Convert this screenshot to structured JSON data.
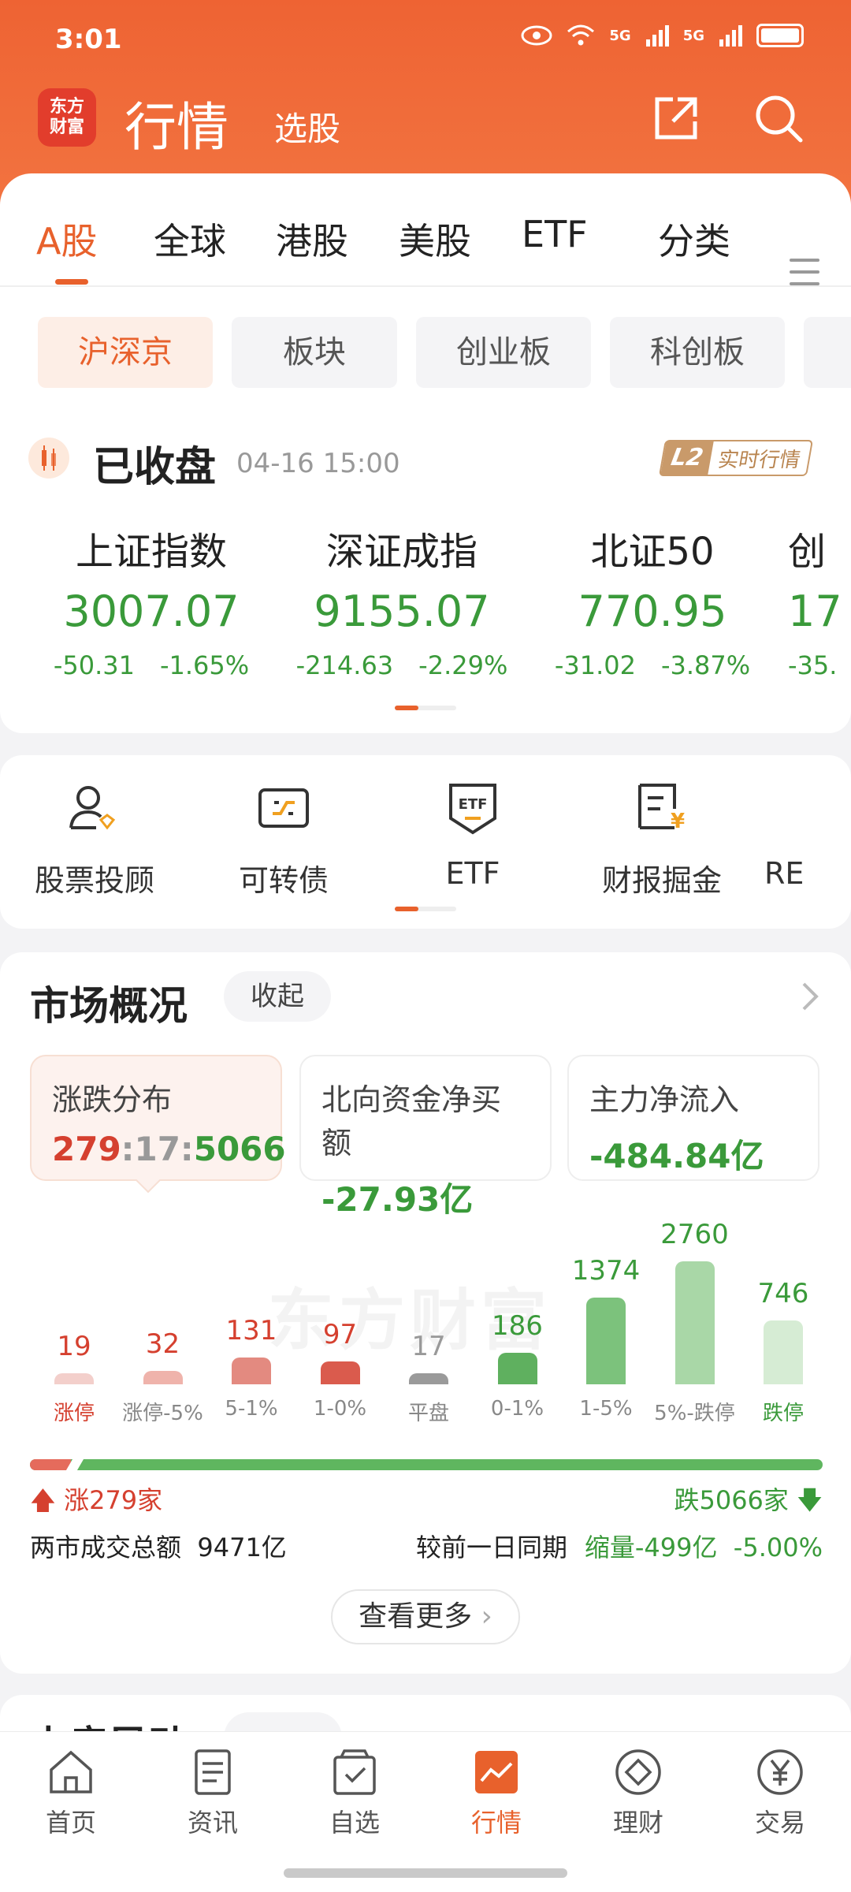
{
  "status": {
    "time": "3:01",
    "signal1": "5G",
    "signal2": "5G"
  },
  "header": {
    "logo_line1": "东方",
    "logo_line2": "财富",
    "title": "行情",
    "subtitle": "选股"
  },
  "tabs": [
    "A股",
    "全球",
    "港股",
    "美股",
    "ETF",
    "分类"
  ],
  "chips": [
    "沪深京",
    "板块",
    "创业板",
    "科创板"
  ],
  "market_status": {
    "title": "已收盘",
    "time": "04-16 15:00",
    "badge_l2": "L2",
    "badge_text": "实时行情"
  },
  "indices": [
    {
      "name": "上证指数",
      "value": "3007.07",
      "change": "-50.31",
      "pct": "-1.65%"
    },
    {
      "name": "深证成指",
      "value": "9155.07",
      "change": "-214.63",
      "pct": "-2.29%"
    },
    {
      "name": "北证50",
      "value": "770.95",
      "change": "-31.02",
      "pct": "-3.87%"
    },
    {
      "name": "创",
      "value": "17",
      "change": "-35.",
      "pct": ""
    }
  ],
  "tools": [
    {
      "label": "股票投顾",
      "icon": "advisor-icon"
    },
    {
      "label": "可转债",
      "icon": "convertible-bond-icon"
    },
    {
      "label": "ETF",
      "icon": "etf-icon"
    },
    {
      "label": "财报掘金",
      "icon": "financial-report-icon"
    },
    {
      "label": "RE",
      "icon": "reits-icon"
    }
  ],
  "overview": {
    "title": "市场概况",
    "collapse_label": "收起",
    "stats": [
      {
        "label": "涨跌分布",
        "up": "279",
        "flat": "17",
        "down": "5066",
        "sep": ":"
      },
      {
        "label": "北向资金净买额",
        "value": "-27.93亿"
      },
      {
        "label": "主力净流入",
        "value": "-484.84亿"
      }
    ],
    "watermark": "东方财富",
    "distribution": [
      {
        "label": "涨停",
        "count": 19,
        "color": "#f3cfcb",
        "text": "#d5402f"
      },
      {
        "label": "涨停-5%",
        "count": 32,
        "color": "#efb3ab",
        "text": "#d5402f"
      },
      {
        "label": "5-1%",
        "count": 131,
        "color": "#e38a80",
        "text": "#d5402f"
      },
      {
        "label": "1-0%",
        "count": 97,
        "color": "#da5b4d",
        "text": "#d5402f"
      },
      {
        "label": "平盘",
        "count": 17,
        "color": "#9a9a9a",
        "text": "#999999"
      },
      {
        "label": "0-1%",
        "count": 186,
        "color": "#5fb05f",
        "text": "#3a9a3a"
      },
      {
        "label": "1-5%",
        "count": 1374,
        "color": "#7cc27c",
        "text": "#3a9a3a"
      },
      {
        "label": "5%-跌停",
        "count": 2760,
        "color": "#a9d7a7",
        "text": "#3a9a3a"
      },
      {
        "label": "跌停",
        "count": 746,
        "color": "#d6ecd4",
        "text": "#3a9a3a"
      }
    ],
    "up_label": "涨279家",
    "down_label": "跌5066家",
    "up_fraction": 0.052,
    "volume_label": "两市成交总额",
    "volume_value": "9471亿",
    "compare_label": "较前一日同期",
    "compare_value": "缩量-499亿",
    "compare_pct": "-5.00%",
    "more_label": "查看更多"
  },
  "next_section_title": "上房异动",
  "bottom_nav": [
    {
      "label": "首页",
      "icon": "home-icon"
    },
    {
      "label": "资讯",
      "icon": "news-icon"
    },
    {
      "label": "自选",
      "icon": "watchlist-icon"
    },
    {
      "label": "行情",
      "icon": "market-icon",
      "active": true
    },
    {
      "label": "理财",
      "icon": "wealth-icon"
    },
    {
      "label": "交易",
      "icon": "trade-icon"
    }
  ],
  "colors": {
    "accent": "#e8612c",
    "up": "#d5402f",
    "down": "#3a9a3a",
    "header": "#ee6333"
  }
}
